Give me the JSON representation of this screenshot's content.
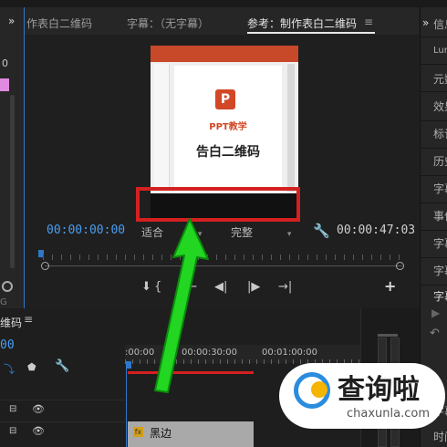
{
  "left_panel": {
    "chevron": "»",
    "zero_label": "0",
    "bottom_label": "G",
    "accent_pink": "#e08ae0"
  },
  "monitor": {
    "tabs": {
      "t1": "作表白二维码",
      "t2": "字幕：（无字幕）",
      "t3": "参考：制作表白二维码",
      "menu": "≡"
    },
    "video": {
      "ppt_logo": "P",
      "ppt_brand": "PPT教学",
      "slide_title": "告白二维码"
    },
    "controls": {
      "timecode_current": "00:00:00:00",
      "zoom": "适合",
      "quality": "完整",
      "timecode_duration": "00:00:47:03"
    },
    "transport": {
      "marker": "⬇",
      "mark_in": "{",
      "go_in": "|←",
      "step_back": "◀|",
      "step_fwd": "|▶",
      "go_out": "→|",
      "add": "+"
    }
  },
  "right_panel": {
    "chevron": "»",
    "items": [
      "信息",
      "Lum",
      "元数",
      "效果",
      "标记",
      "历史",
      "字幕",
      "事件",
      "字幕",
      "字幕",
      "字幕"
    ],
    "bottom_items": [
      "字幕",
      "时间"
    ]
  },
  "timeline": {
    "title": "维码",
    "menu": "≡",
    "timecode": "00",
    "ruler_labels": [
      ":00:00",
      "00:00:30:00",
      "00:01:00:00"
    ],
    "track_icon": "⊟",
    "eye_icon": "👁",
    "clip_fx": "fx",
    "clip_label": "黑边"
  },
  "watermark": {
    "text": "查询啦",
    "url": "chaxunla.com"
  },
  "colors": {
    "accent_blue": "#4a9ef2",
    "highlight_red": "#d42020",
    "arrow_green": "#22d622",
    "ppt_orange": "#d24726"
  }
}
